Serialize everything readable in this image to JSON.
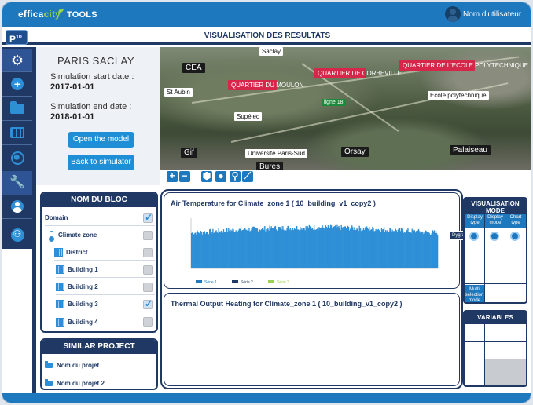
{
  "header": {
    "logo_prefix": "effica",
    "logo_city": "city",
    "logo_suffix": "TOOLS",
    "user_name": "Nom d'utilisateur",
    "badge": "P",
    "badge_sup": "10"
  },
  "page_title": "VISUALISATION DES RESULTATS",
  "nav": {
    "items": [
      "settings",
      "add",
      "folder",
      "grid",
      "globe",
      "tools",
      "user",
      "group"
    ]
  },
  "info": {
    "site_name": "PARIS  SACLAY",
    "start_label": "Simulation start date :",
    "start_value": "2017-01-01",
    "end_label": "Simulation end date :",
    "end_value": "2018-01-01",
    "open_button": "Open the model",
    "back_button": "Back to simulator"
  },
  "map": {
    "labels_dark": [
      "CEA",
      "Gif",
      "Orsay",
      "Palaiseau",
      "Bures"
    ],
    "labels_white": [
      "St Aubin",
      "Supélec",
      "Université Paris-Sud",
      "Ecole polytechnique",
      "Saclay"
    ],
    "quarters": [
      "QUARTIER DU MOULON",
      "QUARTIER DE CORBEVILLE",
      "QUARTIER DE L'ECOLE POLYTECHNIQUE"
    ],
    "line_label": "ligne 18",
    "toolbar": [
      "+",
      "−"
    ]
  },
  "blocks": {
    "title": "NOM DU BLOC",
    "rows": [
      {
        "label": "Domain",
        "checked": true
      },
      {
        "label": "Climate zone",
        "checked": false
      },
      {
        "label": "District",
        "checked": false
      },
      {
        "label": "Building 1",
        "checked": false
      },
      {
        "label": "Building 2",
        "checked": false
      },
      {
        "label": "Building 3",
        "checked": true
      },
      {
        "label": "Building 4",
        "checked": false
      }
    ]
  },
  "similar": {
    "title": "SIMILAR PROJECT",
    "rows": [
      "Nom du projet",
      "Nom du projet 2"
    ]
  },
  "charts": {
    "chart1_title": "Air Temperature for Climate_zone 1 ( 10_building_v1_copy2 )",
    "chart2_title": "Thermal Output Heating for Climate_zone 1 ( 10_building_v1_copy2 )",
    "dygraph_tag": "Dygraph"
  },
  "chart_data": {
    "type": "bar",
    "title": "Air Temperature for Climate_zone 1 ( 10_building_v1_copy2 )",
    "legend": [
      "Série 1",
      "Série 2",
      "Série 3"
    ],
    "legend_colors": [
      "#1e78be",
      "#1f3864",
      "#9bd24b"
    ],
    "series_color": "#2e8fd6",
    "bar_count": 300,
    "profile": "dense bars, near-flat high plateau"
  },
  "right": {
    "vis_title": "VISUALISATION MODE",
    "col_heads": [
      "Display type",
      "Display mode",
      "Chart type"
    ],
    "multi_label": "Multi selection mode",
    "vars_title": "VARIABLES"
  }
}
